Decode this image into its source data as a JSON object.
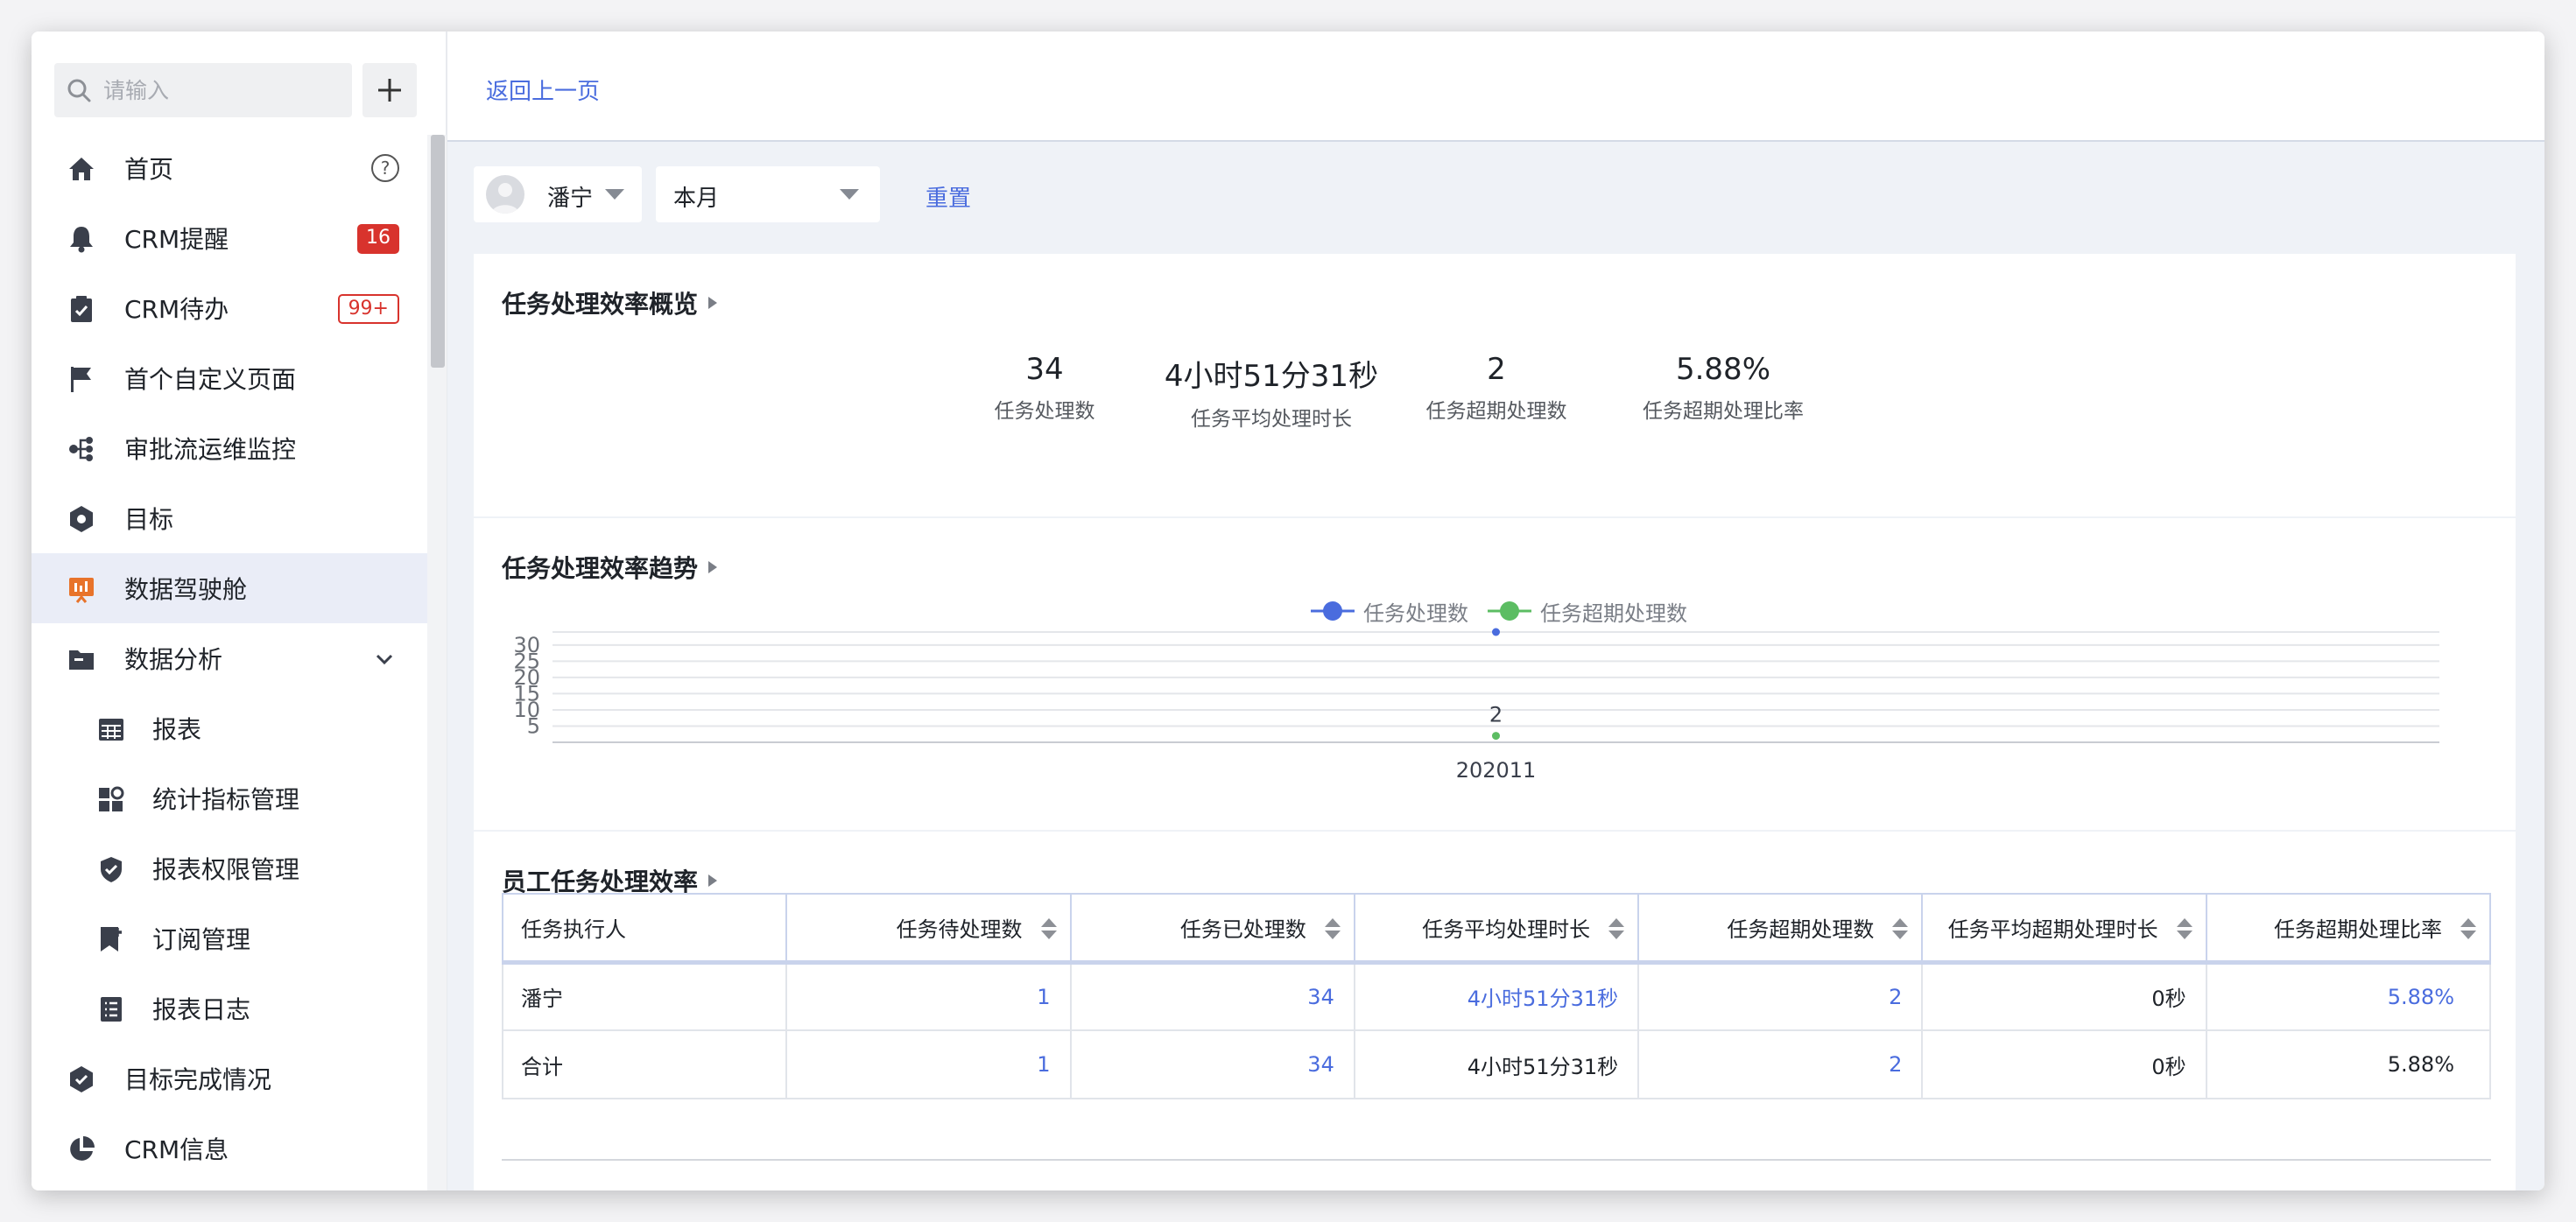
{
  "sidebar": {
    "search_placeholder": "请输入",
    "items": [
      {
        "label": "首页"
      },
      {
        "label": "CRM提醒",
        "badge": "16"
      },
      {
        "label": "CRM待办",
        "badge": "99+"
      },
      {
        "label": "首个自定义页面"
      },
      {
        "label": "审批流运维监控"
      },
      {
        "label": "目标"
      },
      {
        "label": "数据驾驶舱"
      },
      {
        "label": "数据分析"
      },
      {
        "label": "报表"
      },
      {
        "label": "统计指标管理"
      },
      {
        "label": "报表权限管理"
      },
      {
        "label": "订阅管理"
      },
      {
        "label": "报表日志"
      },
      {
        "label": "目标完成情况"
      },
      {
        "label": "CRM信息"
      }
    ]
  },
  "topbar": {
    "back_label": "返回上一页"
  },
  "filters": {
    "user": "潘宁",
    "period": "本月",
    "reset_label": "重置"
  },
  "overview": {
    "title": "任务处理效率概览",
    "metrics": [
      {
        "value": "34",
        "label": "任务处理数"
      },
      {
        "value": "4小时51分31秒",
        "label": "任务平均处理时长"
      },
      {
        "value": "2",
        "label": "任务超期处理数"
      },
      {
        "value": "5.88%",
        "label": "任务超期处理比率"
      }
    ]
  },
  "trend": {
    "title": "任务处理效率趋势"
  },
  "chart_data": {
    "type": "line",
    "title": "",
    "categories": [
      "202011"
    ],
    "series": [
      {
        "name": "任务处理数",
        "values": [
          34
        ],
        "color": "#4a6cde"
      },
      {
        "name": "任务超期处理数",
        "values": [
          2
        ],
        "color": "#5cbd63"
      }
    ],
    "yticks": [
      5,
      10,
      15,
      20,
      25,
      30
    ],
    "ylim": [
      0,
      34
    ],
    "grid": true,
    "legend": "top-center"
  },
  "employee": {
    "title": "员工任务处理效率",
    "columns": [
      "任务执行人",
      "任务待处理数",
      "任务已处理数",
      "任务平均处理时长",
      "任务超期处理数",
      "任务平均超期处理时长",
      "任务超期处理比率"
    ],
    "rows": [
      [
        "潘宁",
        "1",
        "34",
        "4小时51分31秒",
        "2",
        "0秒",
        "5.88%"
      ],
      [
        "合计",
        "1",
        "34",
        "4小时51分31秒",
        "2",
        "0秒",
        "5.88%"
      ]
    ]
  },
  "colors": {
    "accent": "#4a6cde",
    "badge_red": "#d8332d",
    "active_bg": "#eaedf7",
    "dashboard_icon": "#e8732a"
  }
}
